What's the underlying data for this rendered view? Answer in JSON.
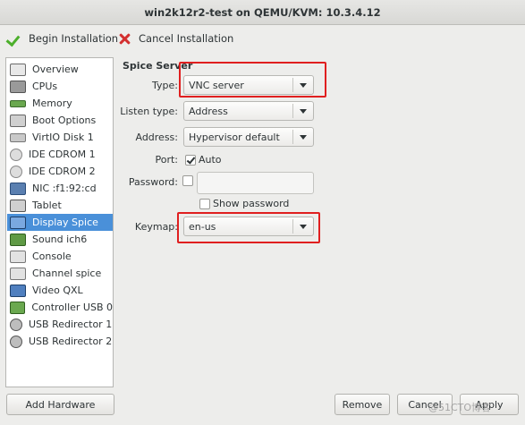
{
  "window": {
    "title": "win2k12r2-test on QEMU/KVM: 10.3.4.12"
  },
  "toolbar": {
    "begin_label": "Begin Installation",
    "cancel_label": "Cancel Installation"
  },
  "sidebar": {
    "items": [
      {
        "label": "Overview",
        "icon": "overview-icon"
      },
      {
        "label": "CPUs",
        "icon": "cpu-icon"
      },
      {
        "label": "Memory",
        "icon": "memory-icon"
      },
      {
        "label": "Boot Options",
        "icon": "boot-options-icon"
      },
      {
        "label": "VirtIO Disk 1",
        "icon": "disk-icon"
      },
      {
        "label": "IDE CDROM 1",
        "icon": "cdrom-icon"
      },
      {
        "label": "IDE CDROM 2",
        "icon": "cdrom-icon"
      },
      {
        "label": "NIC :f1:92:cd",
        "icon": "nic-icon"
      },
      {
        "label": "Tablet",
        "icon": "tablet-icon"
      },
      {
        "label": "Display Spice",
        "icon": "display-icon"
      },
      {
        "label": "Sound ich6",
        "icon": "sound-icon"
      },
      {
        "label": "Console",
        "icon": "console-icon"
      },
      {
        "label": "Channel spice",
        "icon": "channel-icon"
      },
      {
        "label": "Video QXL",
        "icon": "video-icon"
      },
      {
        "label": "Controller USB 0",
        "icon": "controller-icon"
      },
      {
        "label": "USB Redirector 1",
        "icon": "usb-redirector-icon"
      },
      {
        "label": "USB Redirector 2",
        "icon": "usb-redirector-icon"
      }
    ],
    "selected": "Display Spice",
    "add_hardware_label": "Add Hardware"
  },
  "form": {
    "section_title": "Spice Server",
    "type_label": "Type:",
    "type_value": "VNC server",
    "listen_label": "Listen type:",
    "listen_value": "Address",
    "address_label": "Address:",
    "address_value": "Hypervisor default",
    "port_label": "Port:",
    "port_auto_label": "Auto",
    "port_auto_checked": true,
    "password_label": "Password:",
    "password_checked": false,
    "password_value": "",
    "show_password_label": "Show password",
    "show_password_checked": false,
    "keymap_label": "Keymap:",
    "keymap_value": "en-us"
  },
  "buttons": {
    "remove": "Remove",
    "cancel": "Cancel",
    "apply": "Apply"
  },
  "watermark": "@51CTO博客",
  "colors": {
    "selection": "#4a90d9",
    "highlight": "#e01f1f",
    "check_green": "#4caf2b",
    "cancel_red": "#d32f2f"
  }
}
